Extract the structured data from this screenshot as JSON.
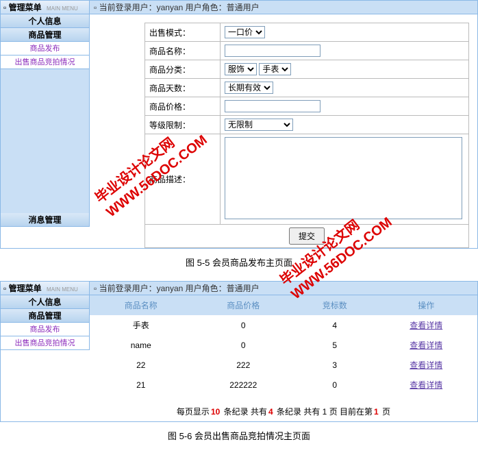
{
  "sidebar": {
    "title": "管理菜单",
    "mainMenu": "MAIN MENU",
    "items": [
      "个人信息",
      "商品管理",
      "商品发布",
      "出售商品竞拍情况",
      "消息管理"
    ]
  },
  "status": {
    "text": "当前登录用户：yanyan 用户角色：普通用户"
  },
  "form": {
    "labels": {
      "saleMode": "出售模式：",
      "productName": "商品名称：",
      "category": "商品分类：",
      "days": "商品天数：",
      "price": "商品价格：",
      "level": "等级限制：",
      "desc": "商品描述："
    },
    "saleModeValue": "一口价",
    "cat1": "服饰",
    "cat2": "手表",
    "daysValue": "长期有效",
    "levelValue": "无限制",
    "productNameValue": "",
    "priceValue": "",
    "descValue": "",
    "submit": "提交"
  },
  "caption1": "图 5-5 会员商品发布主页面",
  "table": {
    "headers": [
      "商品名称",
      "商品价格",
      "竞标数",
      "操作"
    ],
    "rows": [
      {
        "name": "手表",
        "price": "0",
        "bids": "4",
        "op": "查看详情"
      },
      {
        "name": "name",
        "price": "0",
        "bids": "5",
        "op": "查看详情"
      },
      {
        "name": "22",
        "price": "222",
        "bids": "3",
        "op": "查看详情"
      },
      {
        "name": "21",
        "price": "222222",
        "bids": "0",
        "op": "查看详情"
      }
    ]
  },
  "pager": {
    "t1": "每页显示",
    "v1": "10",
    "t2": "条纪录  共有",
    "v2": "4",
    "t3": "条纪录  共有 1 页  目前在第",
    "v3": "1",
    "t4": "页"
  },
  "caption2": "图 5-6 会员出售商品竞拍情况主页面",
  "wm1": "毕业设计论文网",
  "wm2": "WWW.56DOC.COM"
}
